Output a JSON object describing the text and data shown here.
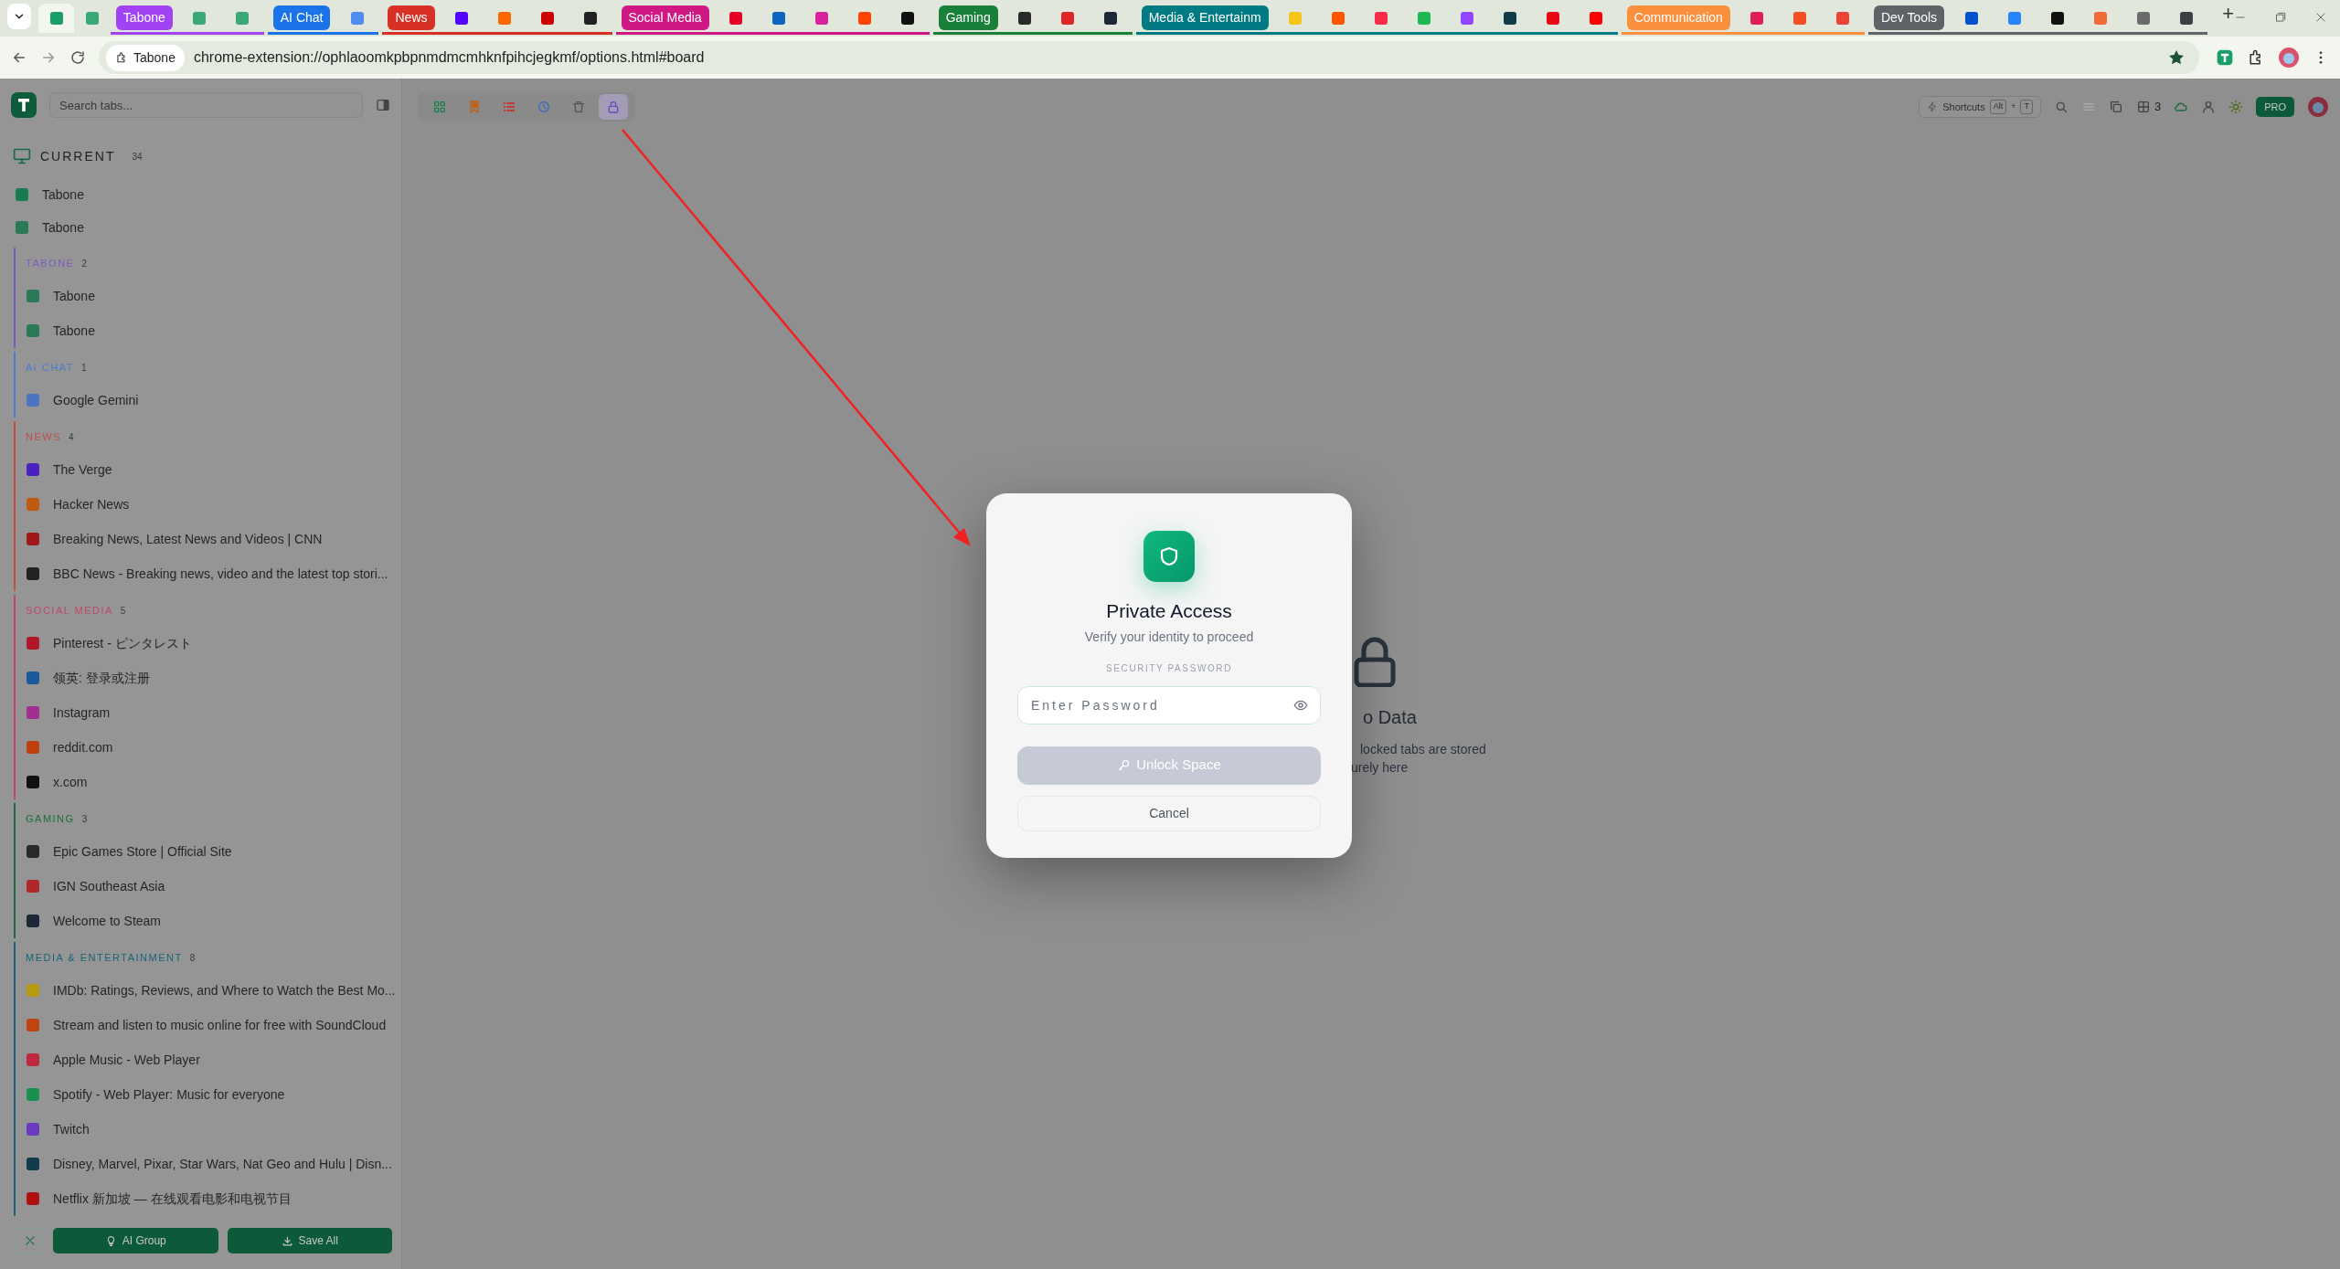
{
  "browser": {
    "tabs": [
      {
        "color": "#1a9e6a",
        "selected": true
      },
      {
        "color": "#3aa776",
        "selected": false
      }
    ],
    "tab_groups": [
      {
        "label": "Tabone",
        "color": "#a142f4",
        "tabs": [
          {
            "color": "#3aa776",
            "selected": false
          },
          {
            "color": "#3aa776",
            "selected": false
          }
        ]
      },
      {
        "label": "AI Chat",
        "color": "#1a73e8",
        "tabs": [
          {
            "color": "#4e8cf0",
            "selected": false
          }
        ]
      },
      {
        "label": "News",
        "color": "#d93025",
        "tabs": [
          {
            "color": "#5200ff",
            "selected": false
          },
          {
            "color": "#ff6600",
            "selected": false
          },
          {
            "color": "#cc0000",
            "selected": false
          },
          {
            "color": "#222222",
            "selected": false
          }
        ]
      },
      {
        "label": "Social Media",
        "color": "#d01884",
        "tabs": [
          {
            "color": "#e60023",
            "selected": false
          },
          {
            "color": "#0a66c2",
            "selected": false
          },
          {
            "color": "#d6249f",
            "selected": false
          },
          {
            "color": "#ff4500",
            "selected": false
          },
          {
            "color": "#111111",
            "selected": false
          }
        ]
      },
      {
        "label": "Gaming",
        "color": "#188038",
        "tabs": [
          {
            "color": "#2a2a2a",
            "selected": false
          },
          {
            "color": "#e0262a",
            "selected": false
          },
          {
            "color": "#1b2838",
            "selected": false
          }
        ]
      },
      {
        "label": "Media & Entertainm",
        "color": "#007b83",
        "tabs": [
          {
            "color": "#f5c518",
            "selected": false
          },
          {
            "color": "#ff5500",
            "selected": false
          },
          {
            "color": "#fa2d48",
            "selected": false
          },
          {
            "color": "#1db954",
            "selected": false
          },
          {
            "color": "#9146ff",
            "selected": false
          },
          {
            "color": "#0f3b4a",
            "selected": false
          },
          {
            "color": "#e50914",
            "selected": false
          },
          {
            "color": "#ff0000",
            "selected": false
          }
        ]
      },
      {
        "label": "Communication",
        "color": "#fa903e",
        "tabs": [
          {
            "color": "#e01e5a",
            "selected": false
          },
          {
            "color": "#f25022",
            "selected": false
          },
          {
            "color": "#ea4335",
            "selected": false
          }
        ]
      },
      {
        "label": "Dev Tools",
        "color": "#5f6368",
        "tabs": [
          {
            "color": "#0052cc",
            "selected": false
          },
          {
            "color": "#2684ff",
            "selected": false
          },
          {
            "color": "#111111",
            "selected": false
          },
          {
            "color": "#f06a35",
            "selected": false
          },
          {
            "color": "#6b6b6b",
            "selected": false
          },
          {
            "color": "#3c4043",
            "selected": false
          }
        ]
      }
    ],
    "new_tab": "+",
    "site_chip": "Tabone",
    "url": "chrome-extension://ophlaoomkpbpnmdmcmhknfpihcjegkmf/options.html#board",
    "bookmarked": true
  },
  "sidebar": {
    "search": {
      "placeholder": "Search tabs..."
    },
    "current": {
      "label": "CURRENT",
      "count": "34",
      "tabs": [
        {
          "title": "Tabone",
          "color": "#1a7a52"
        },
        {
          "title": "Tabone",
          "color": "#2a7a58"
        }
      ]
    },
    "groups": [
      {
        "label": "TABONE",
        "count": "2",
        "color": "#7d5cc0",
        "tabs": [
          {
            "title": "Tabone",
            "color": "#2a7a58"
          },
          {
            "title": "Tabone",
            "color": "#2a7a58"
          }
        ]
      },
      {
        "label": "AI CHAT",
        "count": "1",
        "color": "#4a7bd0",
        "tabs": [
          {
            "title": "Google Gemini",
            "color": "#4a74c0"
          }
        ]
      },
      {
        "label": "NEWS",
        "count": "4",
        "color": "#c0504a",
        "tabs": [
          {
            "title": "The Verge",
            "color": "#4a20c0"
          },
          {
            "title": "Hacker News",
            "color": "#c05a10"
          },
          {
            "title": "Breaking News, Latest News and Videos | CNN",
            "color": "#a01818"
          },
          {
            "title": "BBC News - Breaking news, video and the latest top stori...",
            "color": "#222222"
          }
        ]
      },
      {
        "label": "SOCIAL MEDIA",
        "count": "5",
        "color": "#c04a6a",
        "tabs": [
          {
            "title": "Pinterest - ピンタレスト",
            "color": "#b01828"
          },
          {
            "title": "领英: 登录或注册",
            "color": "#1a5a9a"
          },
          {
            "title": "Instagram",
            "color": "#a03090"
          },
          {
            "title": "reddit.com",
            "color": "#c04010"
          },
          {
            "title": "x.com",
            "color": "#111111"
          }
        ]
      },
      {
        "label": "GAMING",
        "count": "3",
        "color": "#1c6e3a",
        "tabs": [
          {
            "title": "Epic Games Store | Official Site",
            "color": "#2a2a2a"
          },
          {
            "title": "IGN Southeast Asia",
            "color": "#b02828"
          },
          {
            "title": "Welcome to Steam",
            "color": "#1b2838"
          }
        ]
      },
      {
        "label": "MEDIA & ENTERTAINMENT",
        "count": "8",
        "color": "#1a6478",
        "tabs": [
          {
            "title": "IMDb: Ratings, Reviews, and Where to Watch the Best Mo...",
            "color": "#b89a10"
          },
          {
            "title": "Stream and listen to music online for free with SoundCloud",
            "color": "#c04510"
          },
          {
            "title": "Apple Music - Web Player",
            "color": "#c02a40"
          },
          {
            "title": "Spotify - Web Player: Music for everyone",
            "color": "#1a9050"
          },
          {
            "title": "Twitch",
            "color": "#6a3ac0"
          },
          {
            "title": "Disney, Marvel, Pixar, Star Wars, Nat Geo and Hulu | Disn...",
            "color": "#0f3b4a"
          },
          {
            "title": "Netflix 新加坡 — 在线观看电影和电视节目",
            "color": "#b01010"
          }
        ]
      }
    ],
    "footer": {
      "ai_group": "AI Group",
      "save_all": "Save All"
    }
  },
  "toolbar": {
    "views": [
      {
        "color": "#1a8048",
        "selected": false
      },
      {
        "color": "#c06010",
        "selected": false
      },
      {
        "color": "#c03a3a",
        "selected": false
      },
      {
        "color": "#3a6ac0",
        "selected": false
      },
      {
        "color": "#555555",
        "selected": false
      },
      {
        "color": "#6a4ac0",
        "selected": true
      }
    ],
    "shortcuts": {
      "label": "Shortcuts",
      "keys": [
        {
          "kind": "key",
          "text": "Alt"
        },
        {
          "kind": "plus",
          "text": "+"
        },
        {
          "kind": "key",
          "text": "T"
        }
      ]
    },
    "window_count": "3",
    "plan": "PRO"
  },
  "empty_state": {
    "title": "o Data",
    "lines": [
      "locked tabs are stored",
      "urely here"
    ]
  },
  "modal": {
    "title": "Private Access",
    "subtitle": "Verify your identity to proceed",
    "field_label": "SECURITY PASSWORD",
    "password": {
      "placeholder": "Enter Password"
    },
    "unlock": {
      "label": "Unlock Space",
      "disabled": true
    },
    "cancel": "Cancel"
  }
}
